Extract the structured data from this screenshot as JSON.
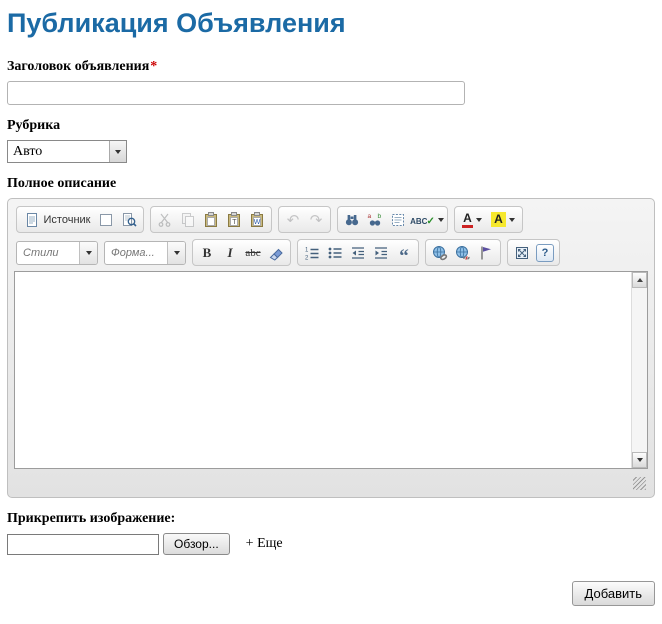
{
  "page": {
    "title": "Публикация Объявления"
  },
  "colors": {
    "title_blue": "#1b6aa5",
    "required_red": "#cc0000",
    "highlight_yellow": "#f6e82e",
    "text_color_red": "#cc2222"
  },
  "form": {
    "title_field": {
      "label": "Заголовок объявления",
      "required_marker": "*",
      "value": ""
    },
    "category_field": {
      "label": "Рубрика",
      "selected_option": "Авто"
    },
    "description_field": {
      "label": "Полное описание"
    },
    "attach_field": {
      "label": "Прикрепить изображение:",
      "value": "",
      "browse_label": "Обзор...",
      "more_label": "+ Еще"
    },
    "submit_label": "Добавить"
  },
  "editor": {
    "content": "",
    "toolbar1": {
      "source_label": "Источник",
      "spellcheck_label": "ABC",
      "text_color_label": "A",
      "bg_color_label": "A"
    },
    "toolbar2": {
      "styles_label": "Стили",
      "format_label": "Форма...",
      "bold_label": "B",
      "italic_label": "I",
      "strike_label": "abc",
      "about_label": "?"
    },
    "icons": {
      "source-doc-icon": "svg page with lines",
      "new-page-icon": "svg blank page",
      "preview-icon": "svg page with magnifier",
      "cut-icon": "svg scissors (disabled)",
      "copy-icon": "svg two pages (disabled)",
      "paste-icon": "svg clipboard",
      "paste-text-icon": "svg clipboard with T",
      "paste-word-icon": "svg clipboard with W",
      "undo-icon": "↶ (disabled)",
      "redo-icon": "↷ (disabled)",
      "find-icon": "svg binoculars",
      "replace-icon": "svg binoculars with a/b",
      "select-all-icon": "svg dashed selection rect",
      "spellcheck-check-icon": "✓",
      "chevron-down-icon": "css triangle ▾",
      "remove-format-icon": "svg eraser",
      "numbered-list-icon": "svg 1-2 list",
      "bulleted-list-icon": "svg bullet list",
      "outdent-icon": "svg lines + left arrow",
      "indent-icon": "svg lines + right arrow",
      "blockquote-icon": "“",
      "link-icon": "svg globe with chain",
      "unlink-icon": "svg globe with broken chain",
      "anchor-icon": "svg flag",
      "maximize-icon": "svg square with arrows",
      "scroll-up-icon": "css triangle ▴",
      "scroll-down-icon": "css triangle ▾",
      "resize-handle": "diagonal stripes"
    }
  }
}
